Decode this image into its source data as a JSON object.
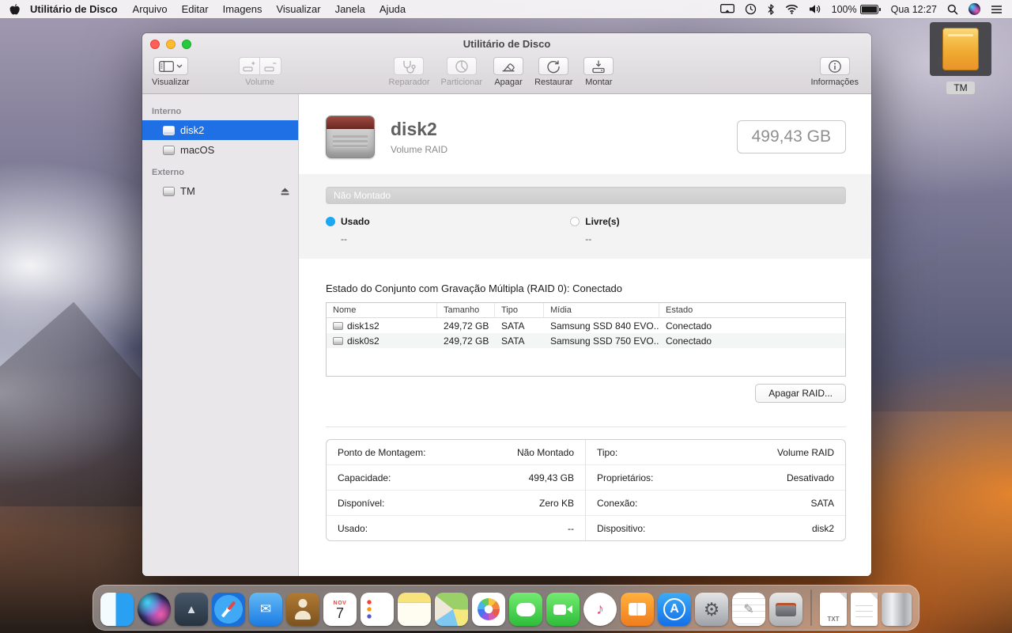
{
  "menu_bar": {
    "app_name": "Utilitário de Disco",
    "menus": [
      "Arquivo",
      "Editar",
      "Imagens",
      "Visualizar",
      "Janela",
      "Ajuda"
    ],
    "status": {
      "battery_label": "100%",
      "clock": "Qua 12:27"
    }
  },
  "desktop": {
    "tm_label": "TM"
  },
  "window": {
    "title": "Utilitário de Disco",
    "toolbar": {
      "view_label": "Visualizar",
      "volume_label": "Volume",
      "buttons": [
        "Reparador",
        "Particionar",
        "Apagar",
        "Restaurar",
        "Montar"
      ],
      "info_label": "Informações"
    },
    "sidebar": {
      "sections": [
        {
          "title": "Interno",
          "items": [
            {
              "label": "disk2",
              "selected": true
            },
            {
              "label": "macOS"
            }
          ]
        },
        {
          "title": "Externo",
          "items": [
            {
              "label": "TM",
              "ejectable": true
            }
          ]
        }
      ]
    },
    "main": {
      "disk_name": "disk2",
      "disk_type": "Volume RAID",
      "disk_size": "499,43 GB",
      "usage_bar_label": "Não Montado",
      "legend": [
        {
          "label": "Usado",
          "value": "--",
          "color": "#1ca7f2"
        },
        {
          "label": "Livre(s)",
          "value": "--",
          "color": "#ffffff"
        }
      ],
      "raid_title": "Estado do Conjunto com Gravação Múltipla (RAID 0): Conectado",
      "table": {
        "headers": [
          "Nome",
          "Tamanho",
          "Tipo",
          "Mídia",
          "Estado"
        ],
        "rows": [
          [
            "disk1s2",
            "249,72 GB",
            "SATA",
            "Samsung SSD 840 EVO...",
            "Conectado"
          ],
          [
            "disk0s2",
            "249,72 GB",
            "SATA",
            "Samsung SSD 750 EVO...",
            "Conectado"
          ]
        ]
      },
      "delete_raid_button": "Apagar RAID...",
      "info_left": [
        {
          "label": "Ponto de Montagem:",
          "value": "Não Montado"
        },
        {
          "label": "Capacidade:",
          "value": "499,43 GB"
        },
        {
          "label": "Disponível:",
          "value": "Zero KB"
        },
        {
          "label": "Usado:",
          "value": "--"
        }
      ],
      "info_right": [
        {
          "label": "Tipo:",
          "value": "Volume RAID"
        },
        {
          "label": "Proprietários:",
          "value": "Desativado"
        },
        {
          "label": "Conexão:",
          "value": "SATA"
        },
        {
          "label": "Dispositivo:",
          "value": "disk2"
        }
      ],
      "selection_color": "#1f6fe5"
    }
  },
  "dock": {
    "items": [
      {
        "name": "finder"
      },
      {
        "name": "siri"
      },
      {
        "name": "launchpad",
        "glyph": "▲"
      },
      {
        "name": "safari"
      },
      {
        "name": "mail",
        "glyph": "✉"
      },
      {
        "name": "contacts"
      },
      {
        "name": "calendar",
        "month": "NOV",
        "day": "7"
      },
      {
        "name": "reminders"
      },
      {
        "name": "notes"
      },
      {
        "name": "maps"
      },
      {
        "name": "photos"
      },
      {
        "name": "messages"
      },
      {
        "name": "facetime"
      },
      {
        "name": "itunes",
        "glyph": "♪"
      },
      {
        "name": "ibooks"
      },
      {
        "name": "app-store",
        "glyph": "A"
      },
      {
        "name": "system-preferences",
        "glyph": "⚙"
      },
      {
        "name": "textedit",
        "glyph": "✎"
      },
      {
        "name": "disk-utility"
      },
      {
        "name": "separator"
      },
      {
        "name": "txt-file",
        "label": "TXT"
      },
      {
        "name": "doc-file"
      },
      {
        "name": "trash"
      }
    ]
  }
}
